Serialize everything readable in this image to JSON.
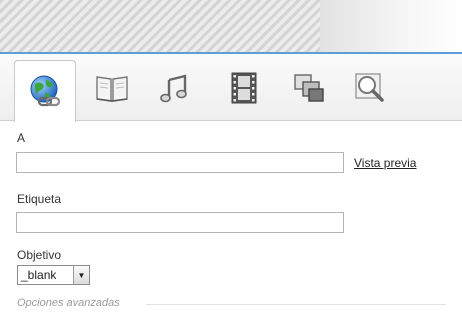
{
  "tabs": [
    {
      "icon": "globe-link-icon",
      "active": true
    },
    {
      "icon": "book-icon",
      "active": false
    },
    {
      "icon": "music-note-icon",
      "active": false
    },
    {
      "icon": "film-strip-icon",
      "active": false
    },
    {
      "icon": "images-icon",
      "active": false
    },
    {
      "icon": "magnifier-icon",
      "active": false
    }
  ],
  "form": {
    "url_label": "A",
    "url_value": "",
    "preview_link": "Vista previa",
    "tag_label": "Etiqueta",
    "tag_value": "",
    "target_label": "Objetivo",
    "target_value": "_blank",
    "advanced_label": "Opciones avanzadas"
  },
  "colors": {
    "accent_line": "#5d9dd8",
    "field_border": "#b5b5b5"
  }
}
